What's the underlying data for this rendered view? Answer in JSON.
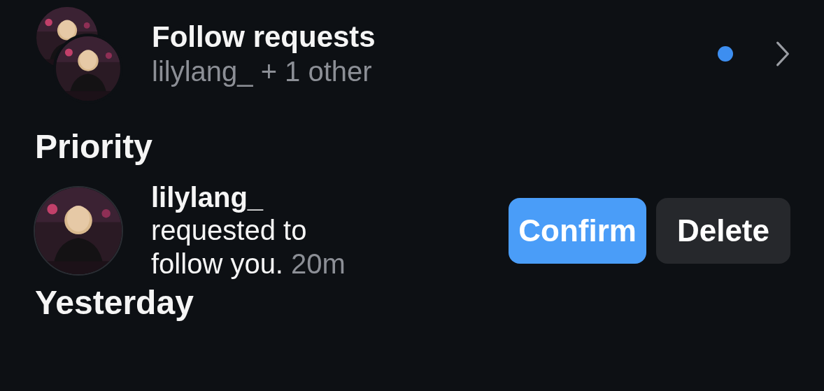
{
  "follow_requests": {
    "title": "Follow requests",
    "subtitle": "lilylang_ + 1 other",
    "unread": true
  },
  "sections": [
    {
      "heading": "Priority",
      "requests": [
        {
          "username": "lilylang_",
          "message": "requested to follow you.",
          "time": "20m",
          "buttons": [
            "Confirm",
            "Delete"
          ]
        }
      ]
    },
    {
      "heading": "Yesterday"
    }
  ]
}
